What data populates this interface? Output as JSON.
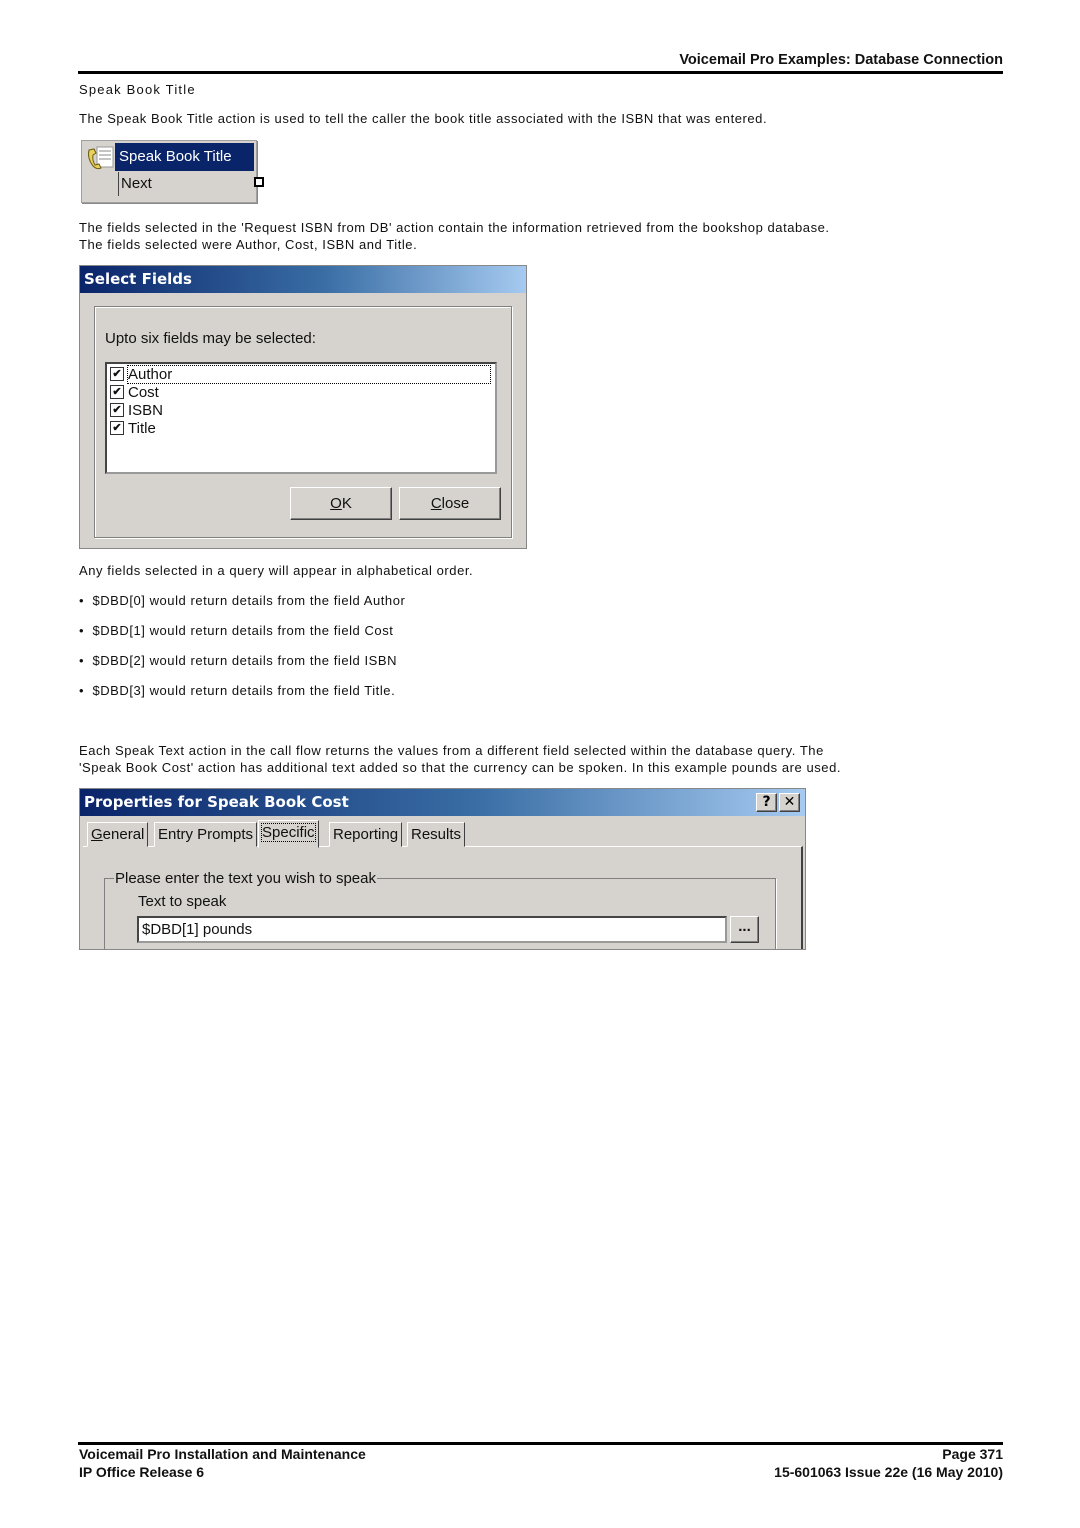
{
  "header": {
    "title": "Voicemail Pro Examples: Database Connection"
  },
  "section": {
    "title": "Speak Book Title",
    "intro": "The Speak Book Title action is used to tell the caller the book title associated with the ISBN that was entered."
  },
  "action_widget": {
    "icon": "phone-list-icon",
    "title": "Speak Book Title",
    "result": "Next"
  },
  "paragraphs": {
    "fields_1": "The fields selected in the 'Request ISBN from DB' action contain the information retrieved from the bookshop database.",
    "fields_2": "The fields selected were Author, Cost, ISBN and Title.",
    "order": "Any fields selected in a query will appear in alphabetical order.",
    "speak_1": "Each Speak Text action in the call flow returns the values from a different field selected within the database query. The",
    "speak_2": "'Speak Book Cost' action has additional text added so that the currency can be spoken. In this example pounds are used."
  },
  "bullets": [
    "$DBD[0] would return details from the field Author",
    "$DBD[1] would return details from the field Cost",
    "$DBD[2] would return details from the field ISBN",
    "$DBD[3] would return details from the field Title."
  ],
  "select_fields_dialog": {
    "title": "Select Fields",
    "label": "Upto six fields may be selected:",
    "fields": [
      {
        "label": "Author",
        "checked": true
      },
      {
        "label": "Cost",
        "checked": true
      },
      {
        "label": "ISBN",
        "checked": true
      },
      {
        "label": "Title",
        "checked": true
      }
    ],
    "ok_mnemonic": "O",
    "ok_rest": "K",
    "close_mnemonic": "C",
    "close_rest": "lose"
  },
  "properties_dialog": {
    "title": "Properties for Speak Book Cost",
    "help_label": "?",
    "close_label": "✕",
    "tabs": [
      {
        "mnemonic": "G",
        "rest": "eneral"
      },
      {
        "mnemonic": "",
        "rest": "Entry Prompts"
      },
      {
        "mnemonic": "",
        "rest": "Specific",
        "active": true
      },
      {
        "mnemonic": "",
        "rest": "Reporting"
      },
      {
        "mnemonic": "",
        "rest": "Results"
      }
    ],
    "group_label": "Please enter the text you wish to speak",
    "field_label": "Text to speak",
    "field_value": "$DBD[1] pounds",
    "browse_label": "..."
  },
  "footer": {
    "left_1": "Voicemail Pro Installation and Maintenance",
    "left_2": "IP Office Release 6",
    "right_1": "Page 371",
    "right_2": "15-601063 Issue 22e (16 May 2010)"
  }
}
